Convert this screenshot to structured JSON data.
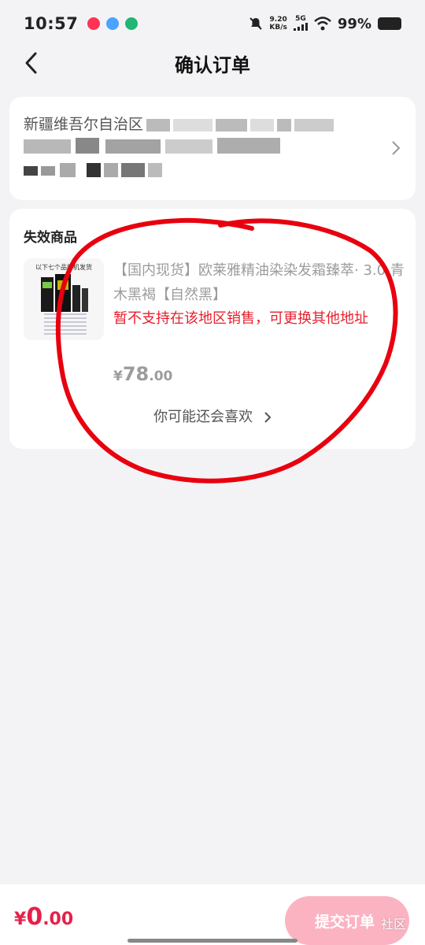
{
  "status_bar": {
    "time": "10:57",
    "network_speed_top": "9.20",
    "network_speed_bottom": "KB/s",
    "signal_label": "5G",
    "battery": "99%"
  },
  "nav": {
    "title": "确认订单"
  },
  "address": {
    "line1_visible": "新疆维吾尔自治区"
  },
  "invalid_section": {
    "title": "失效商品",
    "thumb_caption": "以下七个品牌机发货",
    "product_title": "【国内现货】欧莱雅精油染染发霜臻萃· 3.0 青木黑褐【自然黑】",
    "warning": "暂不支持在该地区销售，可更换其他地址",
    "price_symbol": "¥",
    "price_int": "78",
    "price_dec": ".00",
    "recommend_label": "你可能还会喜欢"
  },
  "bottom": {
    "total_symbol": "¥",
    "total_int": "0",
    "total_dec": ".00",
    "submit_label": "提交订单",
    "watermark": "社区"
  },
  "colors": {
    "accent": "#e6204a",
    "warning": "#e6202e",
    "submit_disabled": "#fbb3c2",
    "annotation": "#e8000f"
  },
  "icons": {
    "back": "chevron-left-icon",
    "address_arrow": "chevron-right-icon",
    "recommend_arrow": "chevron-right-icon"
  }
}
